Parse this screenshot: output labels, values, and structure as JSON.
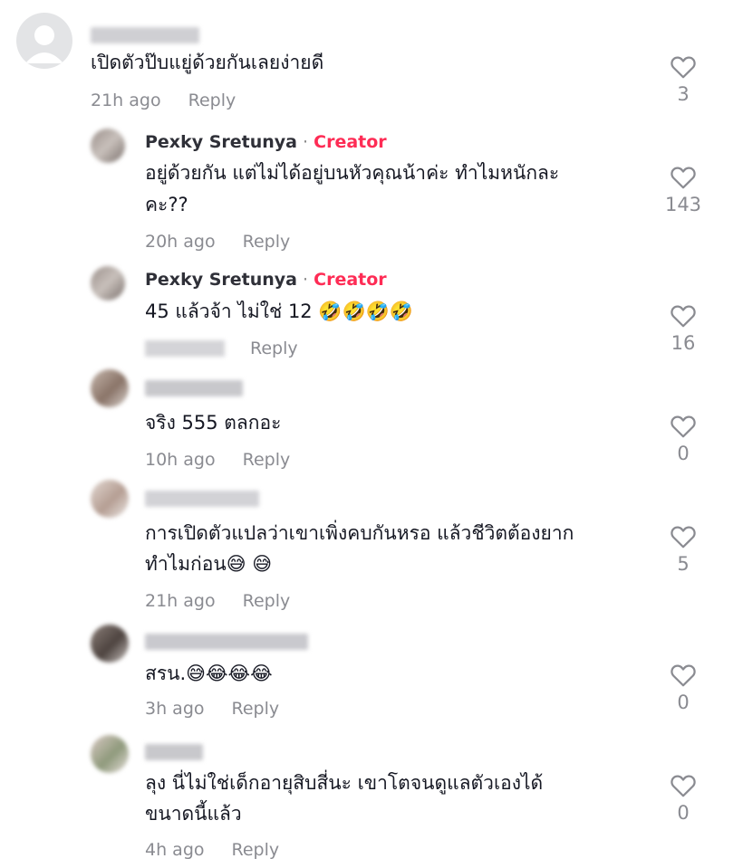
{
  "comments": [
    {
      "text1": "เปิดตัวป๊บแยู่ด้วยกันเลยง่ายดี",
      "text2": "",
      "time": "21h ago",
      "reply": "Reply",
      "likes": "3"
    },
    {
      "name": "Pexky Sretunya",
      "badge": "Creator",
      "sep": " · ",
      "text1": "อยู่ด้วยกัน แต่ไม่ได้อยู่บนหัวคุณน้าค่ะ ทำไมหนักละ",
      "text2": "คะ??",
      "time": "20h ago",
      "reply": "Reply",
      "likes": "143"
    },
    {
      "name": "Pexky Sretunya",
      "badge": "Creator",
      "sep": " · ",
      "text1": "45 แล้วจ้า ไม่ใช่ 12 🤣🤣🤣🤣",
      "text2": "",
      "time": "",
      "reply": "Reply",
      "likes": "16"
    },
    {
      "text1": "จริง 555 ตลกอะ",
      "text2": "",
      "time": "10h ago",
      "reply": "Reply",
      "likes": "0"
    },
    {
      "text1": "การเปิดตัวแปลว่าเขาเพิ่งคบกันหรอ แล้วชีวิตต้องยาก",
      "text2": "ทำไมก่อน😅 😅",
      "time": "21h ago",
      "reply": "Reply",
      "likes": "5"
    },
    {
      "text1": "สรน.😅😂😂😂",
      "text2": "",
      "time": "3h ago",
      "reply": "Reply",
      "likes": "0"
    },
    {
      "text1": "ลุง นี่ไม่ใช่เด็กอายุสิบสี่นะ เขาโตจนดูแลตัวเองได้",
      "text2": "ขนาดนี้แล้ว",
      "time": "4h ago",
      "reply": "Reply",
      "likes": "0"
    }
  ],
  "colors": {
    "creator": "#fe2c55",
    "meta": "#8a8b91",
    "text": "#161823"
  },
  "icons": {
    "like": "heart-outline-icon"
  }
}
